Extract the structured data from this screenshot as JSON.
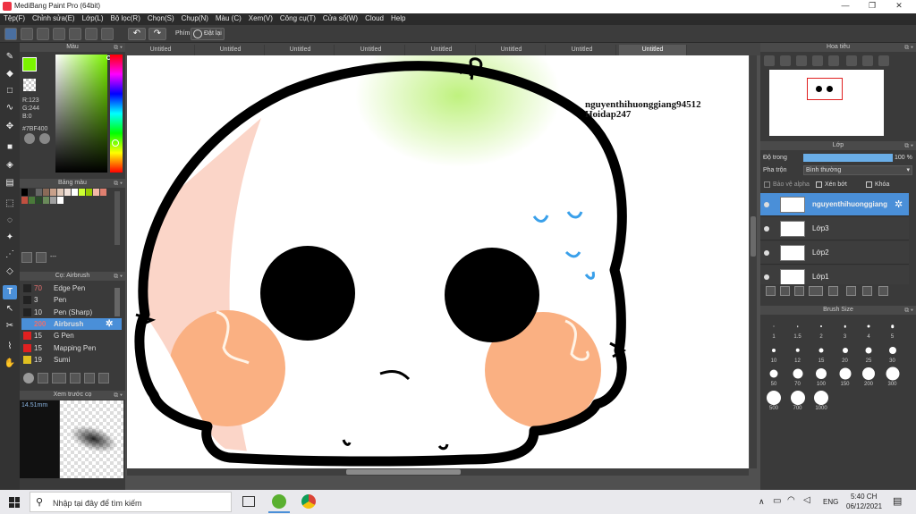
{
  "window": {
    "title": "MediBang Paint Pro (64bit)"
  },
  "menu": [
    "Tệp(F)",
    "Chỉnh sửa(E)",
    "Lớp(L)",
    "Bộ lọc(R)",
    "Chọn(S)",
    "Chụp(N)",
    "Màu (C)",
    "Xem(V)",
    "Công cụ(T)",
    "Cửa sổ(W)",
    "Cloud",
    "Help"
  ],
  "toolbar": {
    "keys_label": "Phím",
    "reset_label": "Đặt lại"
  },
  "color_panel": {
    "title": "Màu",
    "r": "R:123",
    "g": "G:244",
    "b": "B:0",
    "hex": "#7BF400",
    "fg_color": "#7BF400"
  },
  "palette_panel": {
    "title": "Bảng màu",
    "dash_label": "---",
    "swatches": [
      "#000000",
      "#333333",
      "#666666",
      "#8a6a58",
      "#c8a08a",
      "#e0c8b8",
      "#f0e0d8",
      "#ffffff",
      "#ccff33",
      "#99cc00",
      "#f4b8a8",
      "#e08070",
      "#c05040",
      "#4a7a3a",
      "#2a4a2a",
      "#6a8a5a",
      "#a0a0a0",
      "#ffffff"
    ]
  },
  "brush_panel": {
    "title": "Cọ: Airbrush",
    "brushes": [
      {
        "size": "70",
        "name": "Edge Pen",
        "color": "#222222"
      },
      {
        "size": "3",
        "name": "Pen",
        "color": "#222222"
      },
      {
        "size": "10",
        "name": "Pen (Sharp)",
        "color": "#222222"
      },
      {
        "size": "200",
        "name": "Airbrush",
        "color": "#4a8fd8"
      },
      {
        "size": "15",
        "name": "G Pen",
        "color": "#e02020"
      },
      {
        "size": "15",
        "name": "Mapping Pen",
        "color": "#e02020"
      },
      {
        "size": "19",
        "name": "Sumi",
        "color": "#e0c020"
      }
    ]
  },
  "preview_panel": {
    "title": "Xem trước cọ",
    "size_label": "14.51mm"
  },
  "doc_tabs": [
    "Untitled",
    "Untitled",
    "Untitled",
    "Untitled",
    "Untitled",
    "Untitled",
    "Untitled",
    "Untitled"
  ],
  "canvas": {
    "watermark_line1": "nguyenthihuonggiang94512",
    "watermark_line2": "Hoidap247"
  },
  "navigator": {
    "title": "Hoa tiêu"
  },
  "layer_panel": {
    "title": "Lớp",
    "opacity_label": "Độ trong",
    "opacity_value": "100 %",
    "blend_label": "Pha trộn",
    "blend_value": "Bình thường",
    "protect_alpha": "Bảo vệ alpha",
    "clip": "Xén bớt",
    "lock": "Khóa",
    "layers": [
      "nguyenthihuonggiang",
      "Lớp3",
      "Lớp2",
      "Lớp1"
    ]
  },
  "brush_size_panel": {
    "title": "Brush Size",
    "sizes": [
      "1",
      "1.5",
      "2",
      "3",
      "4",
      "5",
      "10",
      "12",
      "15",
      "20",
      "25",
      "30",
      "50",
      "70",
      "100",
      "150",
      "200",
      "300",
      "500",
      "700",
      "1000"
    ]
  },
  "taskbar": {
    "search_placeholder": "Nhập tại đây để tìm kiếm",
    "lang": "ENG",
    "time": "5:40 CH",
    "date": "06/12/2021"
  }
}
